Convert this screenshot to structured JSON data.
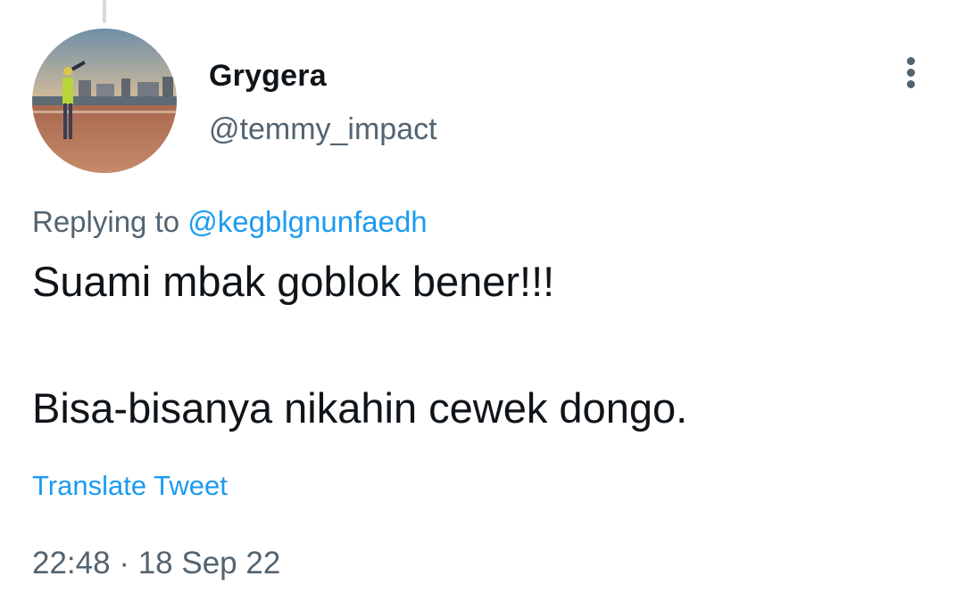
{
  "tweet": {
    "author": {
      "display_name": "Grygera",
      "handle": "@temmy_impact"
    },
    "replying_to_label": "Replying to",
    "replying_to_handle": "@kegblgnunfaedh",
    "text_paragraphs": [
      "Suami mbak goblok bener!!!",
      "Bisa-bisanya nikahin cewek dongo."
    ],
    "translate_label": "Translate Tweet",
    "timestamp": {
      "time": "22:48",
      "separator": "·",
      "date": "18 Sep 22"
    }
  },
  "icons": {
    "more": "more-vertical-icon"
  },
  "colors": {
    "text_primary": "#0f1419",
    "text_secondary": "#536471",
    "link": "#1d9bf0",
    "thread_line": "#cfd9de"
  }
}
